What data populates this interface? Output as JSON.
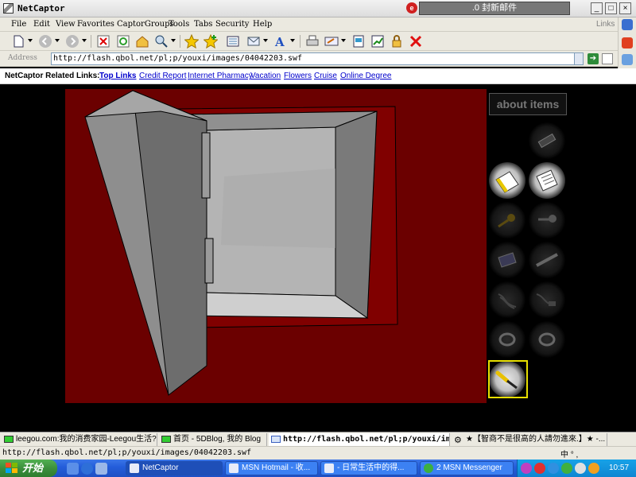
{
  "window": {
    "title": "NetCaptor",
    "mail_text": ".0 封新邮件",
    "controls": {
      "minimize": "_",
      "maximize": "□",
      "close": "×"
    }
  },
  "menu": {
    "items": [
      "File",
      "Edit",
      "View",
      "Favorites",
      "CaptorGroups",
      "Tools",
      "Tabs",
      "Security",
      "Help"
    ],
    "links_label": "Links"
  },
  "toolbar": {
    "icons": [
      "new-icon",
      "back-icon",
      "forward-icon",
      "stop-icon",
      "refresh-icon",
      "home-icon",
      "search-icon",
      "favorites-icon",
      "add-favorite-icon",
      "history-icon",
      "mail-icon",
      "font-icon",
      "print-icon",
      "edit-icon",
      "page-icon",
      "chart-icon",
      "lock-icon",
      "close-red-icon"
    ]
  },
  "address": {
    "label": "Address",
    "url": "http://flash.qbol.net/pl;p/youxi/images/04042203.swf"
  },
  "related_links": {
    "lead": "NetCaptor Related Links:",
    "links": [
      "Top Links",
      "Credit Report",
      "Internet Pharmacy",
      "Vacation",
      "Flowers",
      "Cruise",
      "Online Degree"
    ]
  },
  "game": {
    "about_label": "about items",
    "inventory": [
      {
        "name": "battery",
        "lit": false
      },
      {
        "name": "card",
        "lit": true
      },
      {
        "name": "note",
        "lit": true
      },
      {
        "name": "key-gold",
        "lit": false
      },
      {
        "name": "key-silver",
        "lit": false
      },
      {
        "name": "chip",
        "lit": false
      },
      {
        "name": "rod",
        "lit": false
      },
      {
        "name": "wire",
        "lit": false
      },
      {
        "name": "plug",
        "lit": false
      },
      {
        "name": "ring",
        "lit": false
      },
      {
        "name": "ring-2",
        "lit": false
      },
      {
        "name": "screwdriver",
        "lit": false
      }
    ],
    "colors": {
      "background": "#6b0000",
      "door": "#8e8e8e",
      "interior": "#a8a8a8",
      "highlight": "#e8e000"
    }
  },
  "tabs": [
    {
      "label": "leegou.com:我的消费家园-Leegou生活?...",
      "active": false
    },
    {
      "label": "首页 - 5DBlog, 我的 Blog",
      "active": false
    },
    {
      "label": "http://flash.qbol.net/pl;p/youxi/im...",
      "active": true
    },
    {
      "label": "★【智商不是很高的人請勿進來.】★ -...",
      "active": false
    }
  ],
  "status": {
    "text": "http://flash.qbol.net/pl;p/youxi/images/04042203.swf",
    "ime": "中 ° ,"
  },
  "taskbar": {
    "start_label": "开始",
    "tasks": [
      {
        "label": "NetCaptor",
        "active": true
      },
      {
        "label": "MSN Hotmail - 收...",
        "active": false
      },
      {
        "label": "- 日常生活中的得...",
        "active": false
      },
      {
        "label": "2 MSN Messenger",
        "active": false
      }
    ],
    "clock": "10:57"
  }
}
